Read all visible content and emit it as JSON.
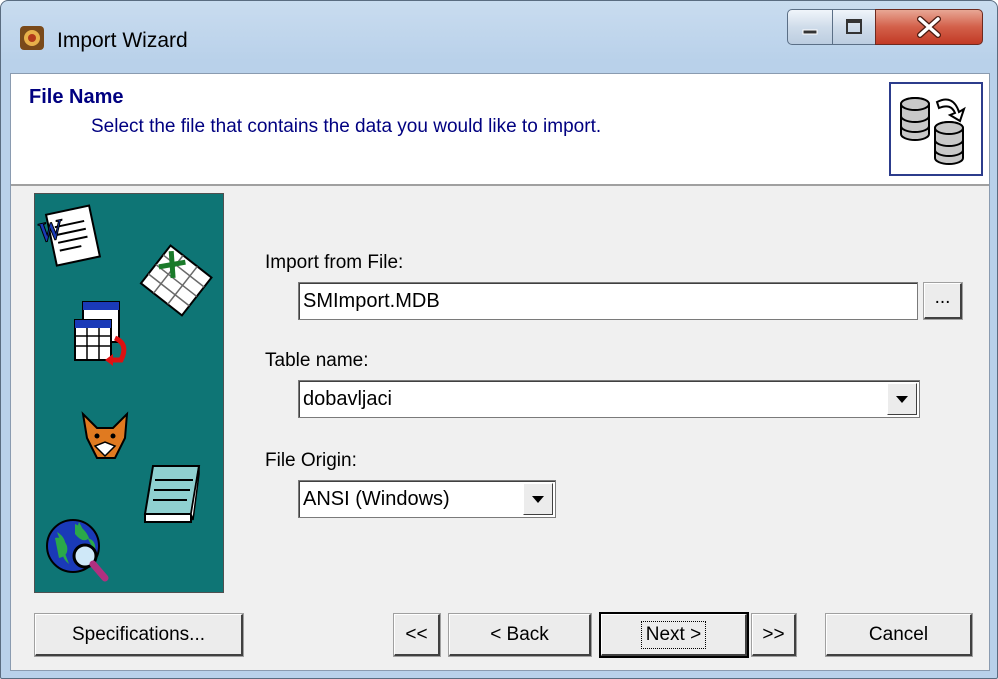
{
  "window": {
    "title": "Import Wizard"
  },
  "header": {
    "title": "File Name",
    "subtitle": "Select the file that contains the data you would like to import."
  },
  "form": {
    "import_label": "Import from File:",
    "import_value": "SMImport.MDB",
    "browse_label": "...",
    "table_label": "Table name:",
    "table_value": "dobavljaci",
    "origin_label": "File Origin:",
    "origin_value": "ANSI (Windows)"
  },
  "buttons": {
    "specifications": "Specifications...",
    "first": "<<",
    "back": "< Back",
    "next": "Next >",
    "last": ">>",
    "cancel": "Cancel"
  },
  "icons": {
    "app": "foxpro-app-icon",
    "header": "database-import-icon",
    "sidebar": [
      "word-document-icon",
      "excel-sheet-icon",
      "table-grid-icon",
      "fox-icon",
      "notepad-icon",
      "globe-search-icon"
    ]
  },
  "colors": {
    "header_text": "#000080",
    "sidebar_bg": "#0e7575"
  }
}
